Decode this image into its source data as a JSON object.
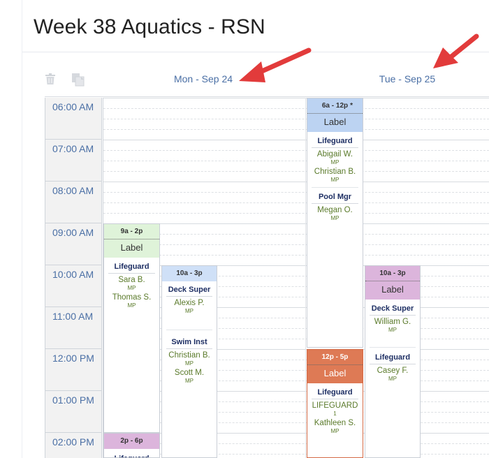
{
  "page": {
    "title": "Week 38 Aquatics - RSN"
  },
  "toolbar": {
    "delete_icon": "trash-icon",
    "copy_icon": "copy-icon"
  },
  "days": [
    {
      "label": "Mon - Sep 24"
    },
    {
      "label": "Tue - Sep 25"
    }
  ],
  "times": [
    "06:00 AM",
    "07:00 AM",
    "08:00 AM",
    "09:00 AM",
    "10:00 AM",
    "11:00 AM",
    "12:00 PM",
    "01:00 PM",
    "02:00 PM"
  ],
  "colors": {
    "accent_arrow": "#e23b3b",
    "time_text": "#4a6fa5",
    "role_text": "#1d2e63",
    "person_text": "#5a7a2a"
  },
  "shifts": {
    "mon_9a": {
      "time": "9a - 2p",
      "label": "Label",
      "roles": [
        {
          "role": "Lifeguard",
          "people": [
            {
              "name": "Sara B.",
              "tag": "MP"
            },
            {
              "name": "Thomas S.",
              "tag": "MP"
            }
          ]
        }
      ]
    },
    "mon_10a": {
      "time": "10a - 3p",
      "roles": [
        {
          "role": "Deck Super",
          "people": [
            {
              "name": "Alexis P.",
              "tag": "MP"
            }
          ]
        },
        {
          "role": "Swim Inst",
          "people": [
            {
              "name": "Christian B.",
              "tag": "MP"
            },
            {
              "name": "Scott M.",
              "tag": "MP"
            }
          ]
        }
      ]
    },
    "mon_2p": {
      "time": "2p - 6p",
      "roles": [
        {
          "role": "Lifeguard"
        }
      ]
    },
    "tue_6a": {
      "time": "6a - 12p",
      "star": "*",
      "label": "Label",
      "roles": [
        {
          "role": "Lifeguard",
          "people": [
            {
              "name": "Abigail W.",
              "tag": "MP"
            },
            {
              "name": "Christian B.",
              "tag": "MP"
            }
          ]
        },
        {
          "role": "Pool Mgr",
          "people": [
            {
              "name": "Megan O.",
              "tag": "MP"
            }
          ]
        }
      ]
    },
    "tue_12p": {
      "time": "12p - 5p",
      "label": "Label",
      "roles": [
        {
          "role": "Lifeguard",
          "people": [
            {
              "name": "LIFEGUARD",
              "tag": "1"
            },
            {
              "name": "Kathleen S.",
              "tag": "MP"
            }
          ]
        }
      ]
    },
    "tue_10a": {
      "time": "10a - 3p",
      "label": "Label",
      "roles": [
        {
          "role": "Deck Super",
          "people": [
            {
              "name": "William G.",
              "tag": "MP"
            }
          ]
        },
        {
          "role": "Lifeguard",
          "people": [
            {
              "name": "Casey F.",
              "tag": "MP"
            }
          ]
        }
      ]
    }
  }
}
